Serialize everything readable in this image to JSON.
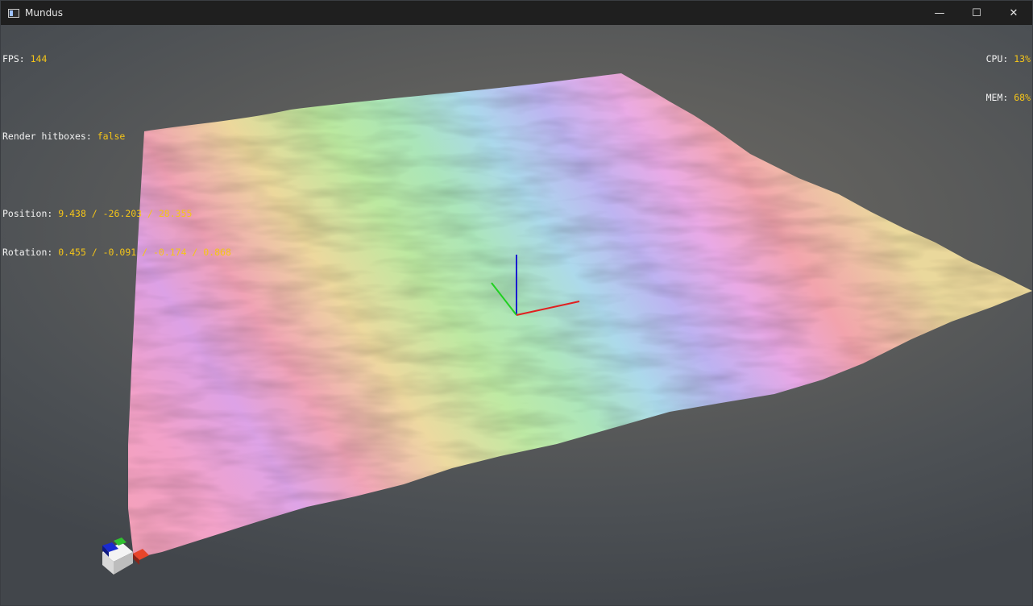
{
  "window": {
    "title": "Mundus",
    "icons": {
      "app": "app-window-icon",
      "minimize": "minimize-icon",
      "maximize": "maximize-icon",
      "close": "close-icon"
    },
    "controls": {
      "minimize": "—",
      "maximize": "☐",
      "close": "✕"
    }
  },
  "hud": {
    "fps_label": "FPS: ",
    "fps_value": "144",
    "hitboxes_label": "Render hitboxes: ",
    "hitboxes_value": "false",
    "position_label": "Position: ",
    "position_value": "9.438 / -26.203 / 28.355",
    "rotation_label": "Rotation: ",
    "rotation_value": "0.455 / -0.091 / -0.174 / 0.868",
    "cpu_label": "CPU: ",
    "cpu_value": "13%",
    "mem_label": "MEM: ",
    "mem_value": "68%"
  },
  "scene": {
    "terrain": "rainbow-heightmap-terrain",
    "axis_colors": {
      "x": "#e02020",
      "y": "#20d020",
      "z": "#1a1ad0"
    },
    "accent_text": "#f5c518"
  }
}
